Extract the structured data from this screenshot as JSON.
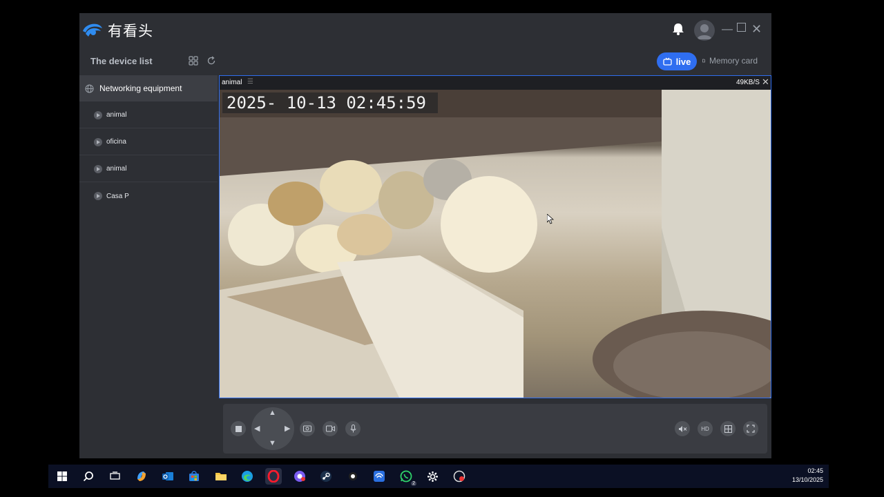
{
  "app": {
    "brand": "有看头",
    "device_list_title": "The device list",
    "live_label": "live",
    "memory_label": "Memory card"
  },
  "sidebar": {
    "group_label": "Networking equipment",
    "devices": [
      "animal",
      "oficina",
      "animal",
      "Casa P"
    ]
  },
  "video": {
    "channel_name": "animal",
    "bitrate": "49KB/S",
    "osd_timestamp": "2025- 10-13   02:45:59"
  },
  "controls": {
    "hd_label": "HD"
  },
  "taskbar": {
    "time": "02:45",
    "date": "13/10/2025",
    "badge": "2"
  },
  "colors": {
    "accent": "#2f6ef0",
    "window_bg": "#2d2f34",
    "sidebar_selected": "#3c3e44"
  }
}
